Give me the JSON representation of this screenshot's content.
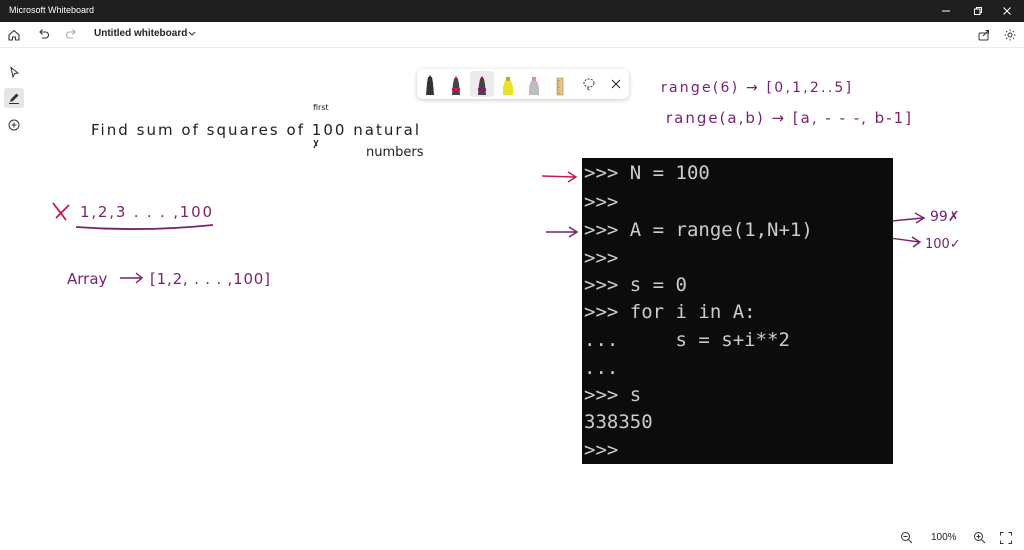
{
  "window": {
    "title": "Microsoft Whiteboard"
  },
  "toolbar": {
    "board_title": "Untitled whiteboard"
  },
  "zoom": {
    "level": "100%"
  },
  "ink": {
    "question_line1": "Find sum of squares of 100 natural",
    "question_first": "first",
    "question_numbers": "numbers",
    "sequence": "1,2,3 . . . ,100",
    "array_label": "Array",
    "array_value": "[1,2, . . . ,100]",
    "range_line1": "range(6) → [0,1,2..5]",
    "range_line2": "range(a,b) → [a, - - -, b-1]",
    "note_99": "99✗",
    "note_100": "100✓"
  },
  "terminal": {
    "lines": [
      ">>> N = 100",
      ">>>",
      ">>> A = range(1,N+1)",
      ">>>",
      ">>> s = 0",
      ">>> for i in A:",
      "...     s = s+i**2",
      "...",
      ">>> s",
      "338350",
      ">>>"
    ]
  },
  "colors": {
    "ink": "#7a1f6f",
    "terminal_bg": "#0c0c0c",
    "terminal_fg": "#cccccc",
    "titlebar": "#1f1f1f"
  }
}
